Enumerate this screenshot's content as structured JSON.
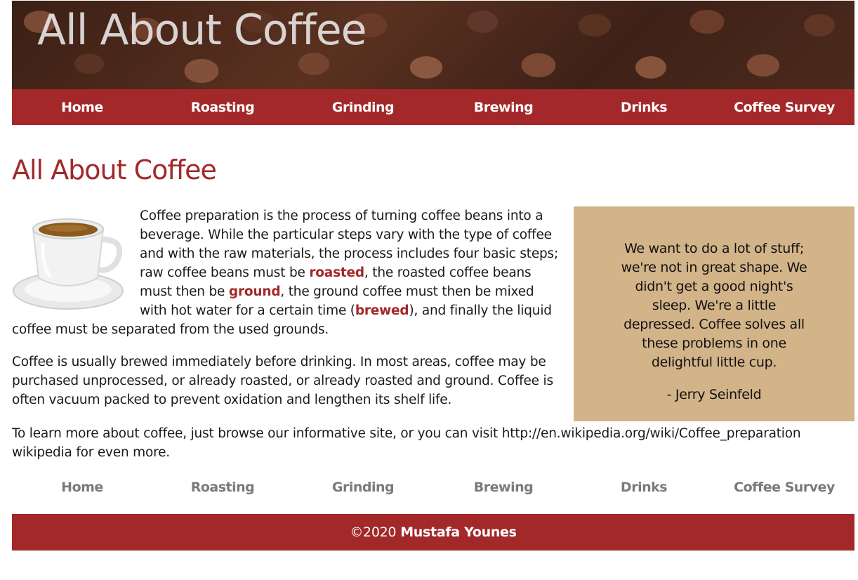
{
  "header": {
    "banner_title": "All About Coffee",
    "nav": [
      "Home",
      "Roasting",
      "Grinding",
      "Brewing",
      "Drinks",
      "Coffee Survey"
    ]
  },
  "main": {
    "heading": "All About Coffee",
    "intro": {
      "part1": "Coffee preparation is the process of turning coffee beans into a beverage. While the particular steps vary with the type of coffee and with the raw materials, the process includes four basic steps; raw coffee beans must be ",
      "link1": "roasted",
      "part2": ", the roasted coffee beans must then be ",
      "link2": "ground",
      "part3": ", the ground coffee must then be mixed with hot water for a certain time (",
      "link3": "brewed",
      "part4": "), and finally the liquid coffee must be separated from the used grounds."
    },
    "paragraph2": "Coffee is usually brewed immediately before drinking. In most areas, coffee may be purchased unprocessed, or already roasted, or already roasted and ground. Coffee is often vacuum packed to prevent oxidation and lengthen its shelf life.",
    "paragraph3": "To learn more about coffee, just browse our informative site, or you can visit http://en.wikipedia.org/wiki/Coffee_preparation wikipedia for even more."
  },
  "quote": {
    "text": "We want to do a lot of stuff; we're not in great shape. We didn't get a good night's sleep. We're a little depressed. Coffee solves all these problems in one delightful little cup.",
    "author": "- Jerry Seinfeld"
  },
  "footer_nav": [
    "Home",
    "Roasting",
    "Grinding",
    "Brewing",
    "Drinks",
    "Coffee Survey"
  ],
  "footer": {
    "copyright": "©2020",
    "author": "Mustafa Younes"
  },
  "colors": {
    "accent": "#a3282a",
    "quote_bg": "#d3b489",
    "footer_nav_text": "#7a7a7a"
  },
  "icons": {
    "cup_image": "coffee-cup-icon"
  }
}
